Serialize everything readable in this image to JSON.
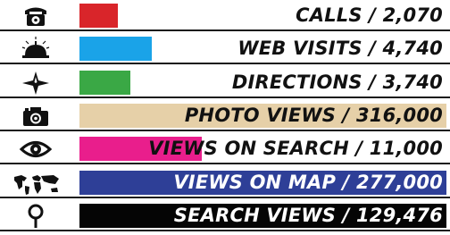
{
  "chart_data": {
    "type": "bar",
    "orientation": "horizontal",
    "categories": [
      "CALLS",
      "WEB VISITS",
      "DIRECTIONS",
      "PHOTO VIEWS",
      "VIEWS ON SEARCH",
      "VIEWS ON MAP",
      "SEARCH VIEWS"
    ],
    "values": [
      2070,
      4740,
      3740,
      316000,
      11000,
      277000,
      129476
    ],
    "bar_scale_max": [
      20000,
      24000,
      27000,
      316000,
      33000,
      277000,
      129476
    ],
    "labels": [
      "CALLS / 2,070",
      "WEB VISITS / 4,740",
      "DIRECTIONS / 3,740",
      "PHOTO VIEWS / 316,000",
      "VIEWS ON SEARCH / 11,000",
      "VIEWS ON MAP / 277,000",
      "SEARCH VIEWS / 129,476"
    ],
    "colors": [
      "#d9252a",
      "#1aa3e8",
      "#3aa845",
      "#e6d0a8",
      "#e91e8c",
      "#2e3f97",
      "#050505"
    ],
    "icons": [
      "telephone-icon",
      "desk-bell-icon",
      "compass-star-icon",
      "camera-icon",
      "eye-icon",
      "world-map-icon",
      "magnifier-icon"
    ],
    "title": "",
    "xlabel": "",
    "ylabel": "",
    "grid": false,
    "legend": "none"
  }
}
